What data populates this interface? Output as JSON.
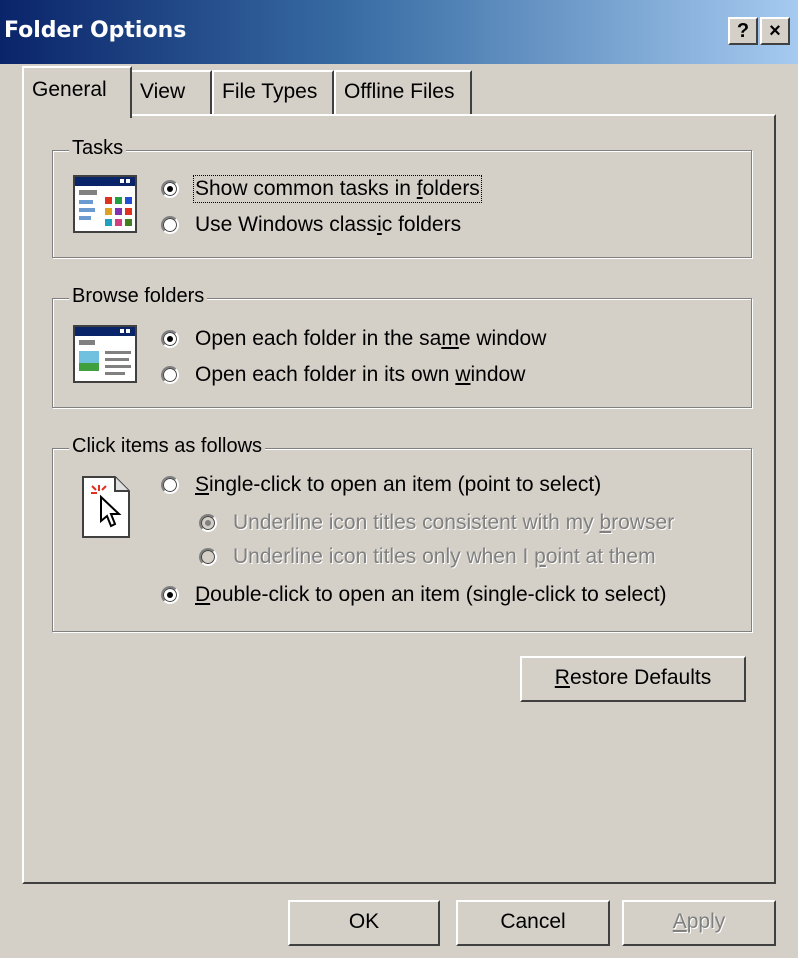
{
  "window": {
    "title": "Folder Options",
    "help_label": "?",
    "close_label": "×"
  },
  "tabs": [
    {
      "label": "General",
      "active": true
    },
    {
      "label": "View"
    },
    {
      "label": "File Types"
    },
    {
      "label": "Offline Files"
    }
  ],
  "tasks": {
    "title": "Tasks",
    "options": [
      {
        "pre": "Show common tasks in ",
        "accel": "f",
        "post": "olders",
        "checked": true
      },
      {
        "pre": "Use Windows class",
        "accel": "i",
        "post": "c folders",
        "checked": false
      }
    ]
  },
  "browse": {
    "title": "Browse folders",
    "options": [
      {
        "pre": "Open each folder in the sa",
        "accel": "m",
        "post": "e window",
        "checked": true
      },
      {
        "pre": "Open each folder in its own ",
        "accel": "w",
        "post": "indow",
        "checked": false
      }
    ]
  },
  "click": {
    "title": "Click items as follows",
    "options": [
      {
        "pre": "",
        "accel": "S",
        "post": "ingle-click to open an item (point to select)",
        "checked": false
      },
      {
        "pre": "Underline icon titles consistent with my ",
        "accel": "b",
        "post": "rowser",
        "checked": true,
        "disabled": true
      },
      {
        "pre": "Underline icon titles only when I ",
        "accel": "p",
        "post": "oint at them",
        "checked": false,
        "disabled": true
      },
      {
        "pre": "",
        "accel": "D",
        "post": "ouble-click to open an item (single-click to select)",
        "checked": true
      }
    ]
  },
  "restore": {
    "accel": "R",
    "post": "estore Defaults"
  },
  "footer": {
    "ok": "OK",
    "cancel": "Cancel",
    "apply_accel": "A",
    "apply_post": "pply"
  },
  "colors": {
    "face": "#d4d0c8",
    "title_start": "#0a246a",
    "title_end": "#a6caf0"
  }
}
